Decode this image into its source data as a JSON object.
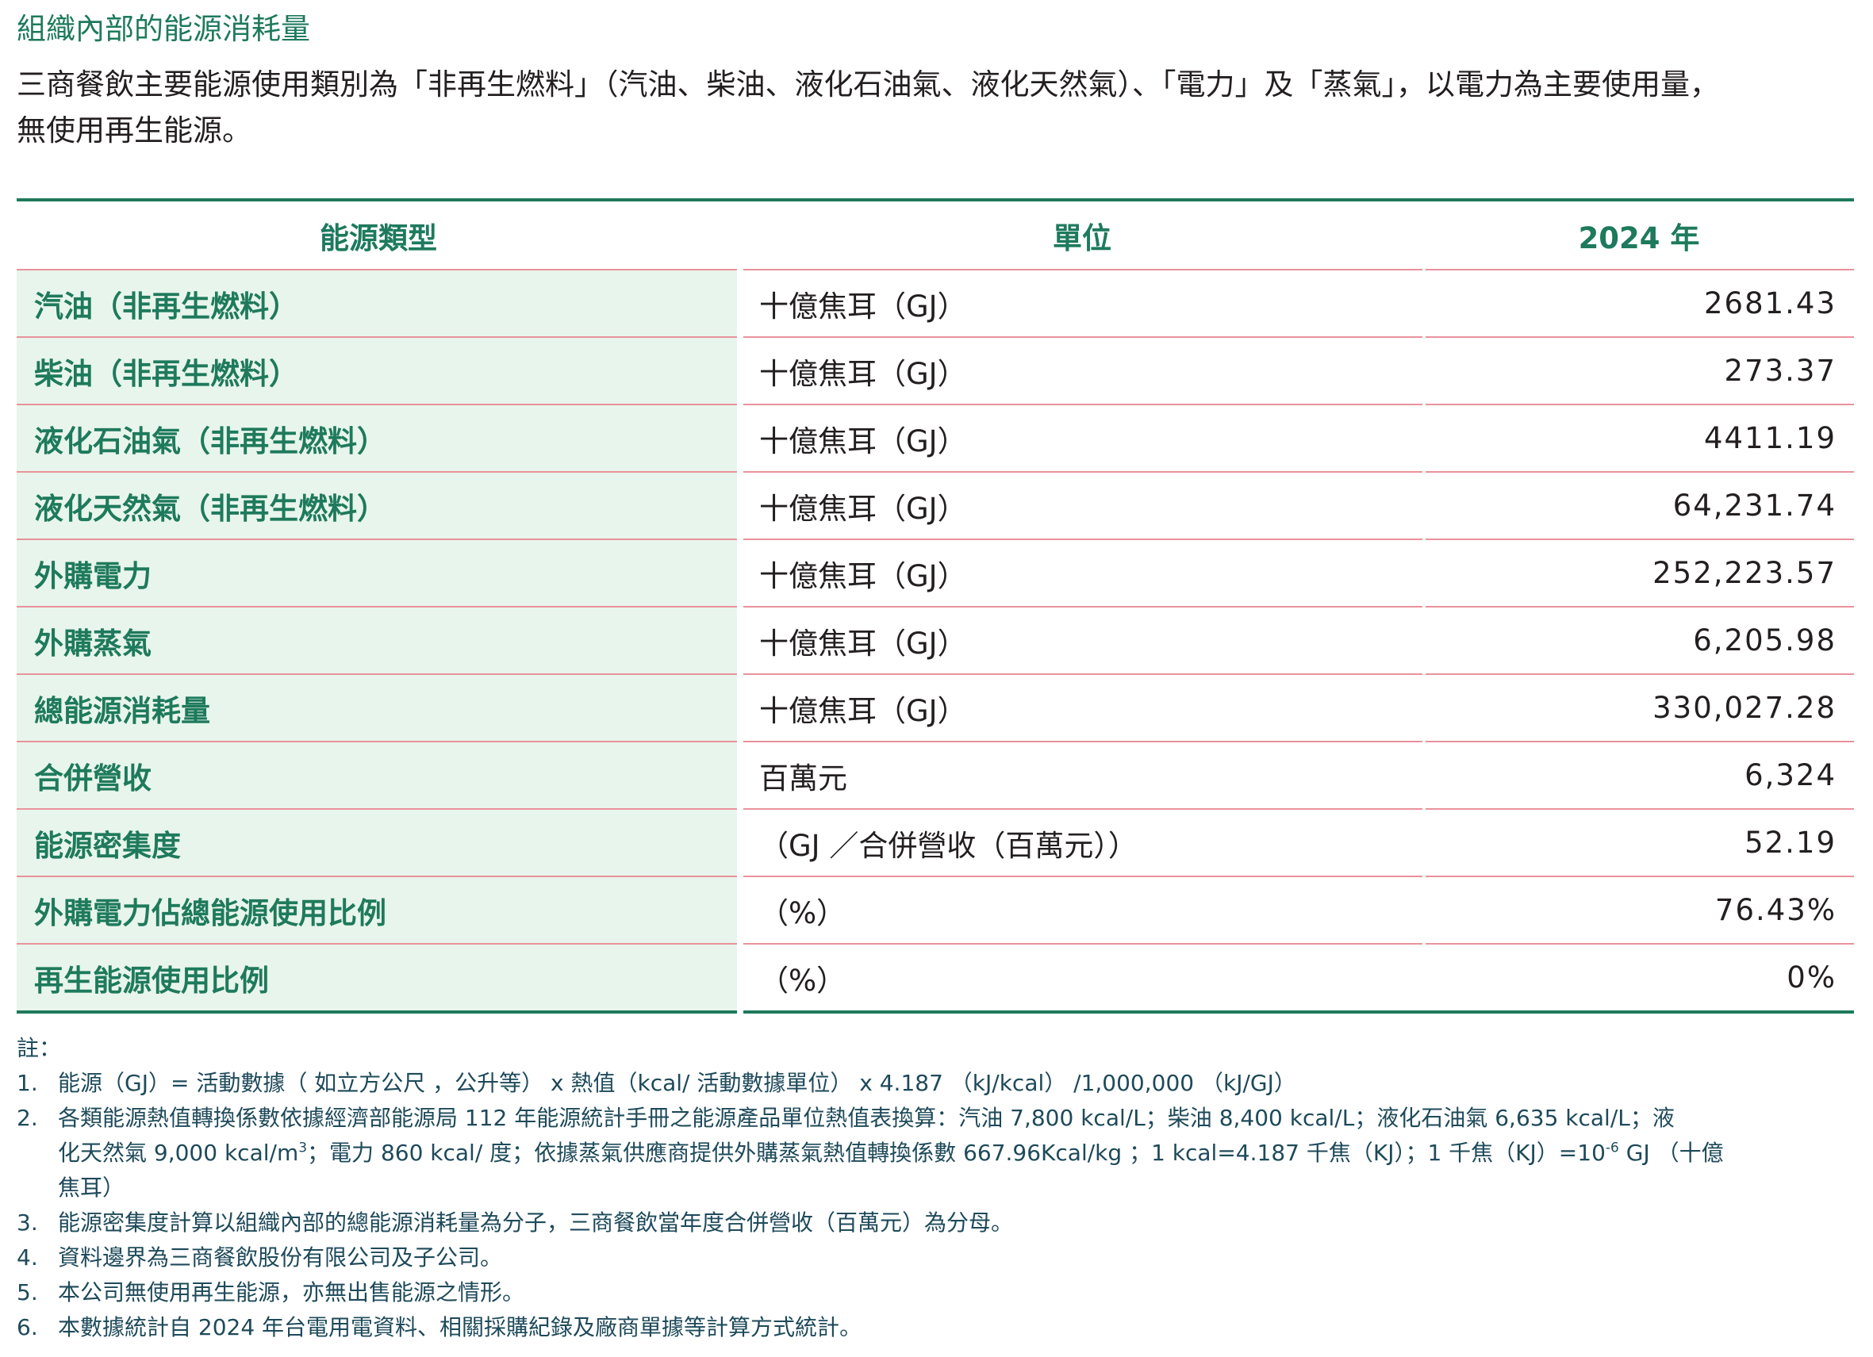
{
  "section_title": "組織內部的能源消耗量",
  "intro": {
    "line1": "三商餐飲主要能源使用類別為「非再生燃料」（汽油、柴油、液化石油氣、液化天然氣）、「電力」及「蒸氣」，以電力為主要使用量，",
    "line2": "無使用再生能源。"
  },
  "table": {
    "headers": [
      "能源類型",
      "單位",
      "2024 年"
    ],
    "rows": [
      {
        "type": "汽油（非再生燃料）",
        "unit": "十億焦耳（GJ）",
        "value": "2681.43"
      },
      {
        "type": "柴油（非再生燃料）",
        "unit": "十億焦耳（GJ）",
        "value": "273.37"
      },
      {
        "type": "液化石油氣（非再生燃料）",
        "unit": "十億焦耳（GJ）",
        "value": "4411.19"
      },
      {
        "type": "液化天然氣（非再生燃料）",
        "unit": "十億焦耳（GJ）",
        "value": "64,231.74"
      },
      {
        "type": "外購電力",
        "unit": "十億焦耳（GJ）",
        "value": "252,223.57"
      },
      {
        "type": "外購蒸氣",
        "unit": "十億焦耳（GJ）",
        "value": "6,205.98"
      },
      {
        "type": "總能源消耗量",
        "unit": "十億焦耳（GJ）",
        "value": "330,027.28"
      },
      {
        "type": "合併營收",
        "unit": "百萬元",
        "value": "6,324"
      },
      {
        "type": "能源密集度",
        "unit": "（GJ ／合併營收（百萬元））",
        "value": "52.19"
      },
      {
        "type": "外購電力佔總能源使用比例",
        "unit": "（%）",
        "value": "76.43%"
      },
      {
        "type": "再生能源使用比例",
        "unit": "（%）",
        "value": "0%"
      }
    ]
  },
  "notes": {
    "heading": "註：",
    "items": [
      {
        "num": "1.",
        "lines": [
          "能源（GJ）= 活動數據（ 如立方公尺 ，公升等） x 熱值（kcal/ 活動數據單位） x 4.187 （kJ/kcal） /1,000,000 （kJ/GJ）"
        ]
      },
      {
        "num": "2.",
        "lines": [
          "各類能源熱值轉換係數依據經濟部能源局 112 年能源統計手冊之能源產品單位熱值表換算：汽油 7,800 kcal/L；柴油 8,400 kcal/L；液化石油氣 6,635 kcal/L；液",
          "化天然氣 9,000 kcal/m",
          "焦耳）"
        ],
        "sup1": "3",
        "line2_rest": "；電力 860 kcal/ 度；依據蒸氣供應商提供外購蒸氣熱值轉換係數 667.96Kcal/kg ；1 kcal=4.187 千焦（KJ）；1 千焦（KJ）=10",
        "sup2": "-6",
        "line2_end": " GJ （十億"
      },
      {
        "num": "3.",
        "lines": [
          "能源密集度計算以組織內部的總能源消耗量為分子，三商餐飲當年度合併營收（百萬元）為分母。"
        ]
      },
      {
        "num": "4.",
        "lines": [
          "資料邊界為三商餐飲股份有限公司及子公司。"
        ]
      },
      {
        "num": "5.",
        "lines": [
          "本公司無使用再生能源，亦無出售能源之情形。"
        ]
      },
      {
        "num": "6.",
        "lines": [
          "本數據統計自 2024 年台電用電資料、相關採購紀錄及廠商單據等計算方式統計。"
        ]
      }
    ]
  },
  "colors": {
    "accent_green": "#1e7a5c",
    "row_fill": "#e8f5ec",
    "divider_pink": "#e9929b",
    "note_text": "#1e4a5a"
  }
}
